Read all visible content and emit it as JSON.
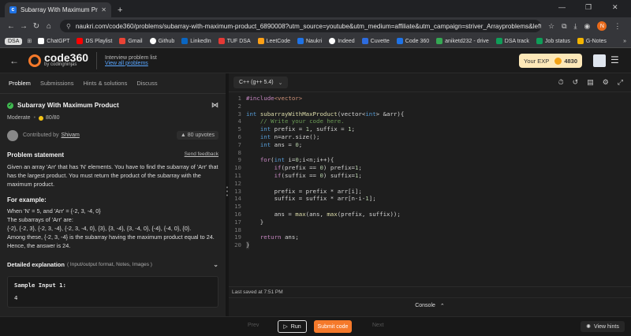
{
  "browser": {
    "tab_title": "Subarray With Maximum Produ",
    "url": "naukri.com/code360/problems/subarray-with-maximum-product_6890008?utm_source=youtube&utm_medium=affiliate&utm_campaign=striver_Arrayproblems&leftPanelTab...",
    "profile_initial": "N",
    "bookmarks": [
      {
        "label": "DSA",
        "color": "#dddddd"
      },
      {
        "label": "ChatGPT",
        "color": "#ffffff"
      },
      {
        "label": "DS Playlist",
        "color": "#ff0000"
      },
      {
        "label": "Gmail",
        "color": "#ea4335"
      },
      {
        "label": "Github",
        "color": "#ffffff"
      },
      {
        "label": "LinkedIn",
        "color": "#0a66c2"
      },
      {
        "label": "TUF DSA",
        "color": "#e53935"
      },
      {
        "label": "LeetCode",
        "color": "#ffa116"
      },
      {
        "label": "Naukri",
        "color": "#1f73e6"
      },
      {
        "label": "Indeed",
        "color": "#ffffff"
      },
      {
        "label": "Cuvette",
        "color": "#2d6cdf"
      },
      {
        "label": "Code 360",
        "color": "#1f73e6"
      },
      {
        "label": "aniketd232 - drive",
        "color": "#34a853"
      },
      {
        "label": "DSA track",
        "color": "#0f9d58"
      },
      {
        "label": "Job status",
        "color": "#0f9d58"
      },
      {
        "label": "G-Notes",
        "color": "#f4b400"
      }
    ]
  },
  "header": {
    "logo_text": "code360",
    "logo_sub": "by codingninjas",
    "list_title": "Interview problem list",
    "list_link": "View all problems",
    "exp_label": "Your EXP",
    "exp_value": "4830"
  },
  "left": {
    "tabs": [
      "Problem",
      "Submissions",
      "Hints & solutions",
      "Discuss"
    ],
    "problem_title": "Subarray With Maximum Product",
    "difficulty": "Moderate",
    "score": "80/80",
    "contributed_label": "Contributed by",
    "contributor": "Shivam",
    "upvotes": "80 upvotes",
    "statement_heading": "Problem statement",
    "send_feedback": "Send feedback",
    "statement": "Given an array 'Arr' that has 'N' elements. You have to find the subarray of 'Arr' that has the largest product. You must return the product of the subarray with the maximum product.",
    "example_heading": "For example:",
    "example_lines": [
      "When 'N' = 5, and 'Arr' = {-2, 3, -4, 0}",
      "The subarrays of 'Arr' are:",
      "{-2}, {-2, 3}, {-2, 3, -4}, {-2, 3, -4, 0}, {3}, {3, -4}, {3, -4, 0}, {-4}, {-4, 0}, {0}.",
      "Among these, {-2, 3, -4} is the subarray having the maximum product equal to 24.",
      "Hence, the answer is 24."
    ],
    "detail_heading": "Detailed explanation",
    "detail_note": "( Input/output format, Notes, Images )",
    "sample_heading": "Sample Input 1:",
    "sample_value": "4"
  },
  "editor": {
    "language": "C++ (g++ 5.4)",
    "lines": [
      "1",
      "2",
      "3",
      "4",
      "5",
      "6",
      "7",
      "8",
      "9",
      "10",
      "11",
      "12",
      "13",
      "14",
      "15",
      "16",
      "17",
      "18",
      "19",
      "20"
    ],
    "saved_text": "Last saved at 7:51 PM",
    "console_label": "Console"
  },
  "bottom": {
    "prev": "Prev",
    "run": "Run",
    "submit": "Submit code",
    "next": "Next",
    "hints": "View hints"
  }
}
